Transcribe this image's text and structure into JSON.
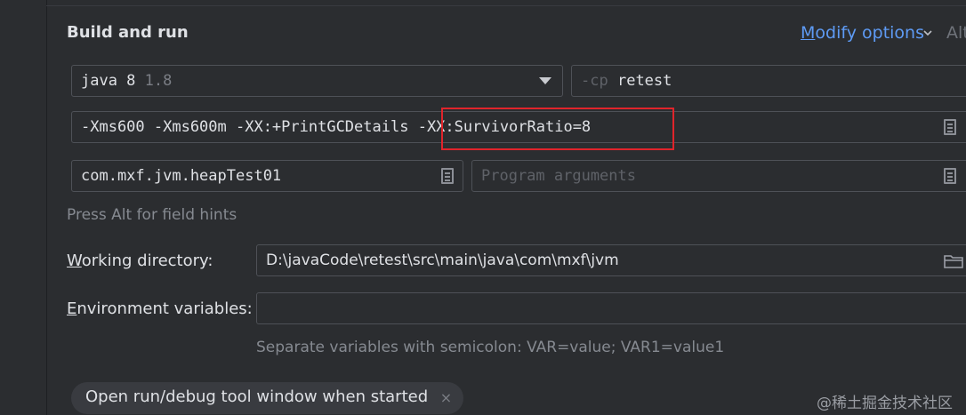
{
  "section": {
    "title": "Build and run"
  },
  "modify_options": {
    "underline_letter": "M",
    "rest": "odify options"
  },
  "alt_hint_top": "Alt",
  "jdk_select": {
    "name": "java 8",
    "version": "1.8"
  },
  "classpath": {
    "prefix": "-cp",
    "value": "retest"
  },
  "vm_options": {
    "before": "-Xms600 -Xms600m -XX:+PrintGCDetails ",
    "highlighted": "-XX:SurvivorRatio=8"
  },
  "main_class": {
    "value": "com.mxf.jvm.heapTest01"
  },
  "program_args": {
    "placeholder": "Program arguments"
  },
  "field_hint": "Press Alt for field hints",
  "working_dir": {
    "label_u": "W",
    "label_rest": "orking directory:",
    "value": "D:\\javaCode\\retest\\src\\main\\java\\com\\mxf\\jvm"
  },
  "env_vars": {
    "label_u": "E",
    "label_rest": "nvironment variables:",
    "value": "",
    "hint": "Separate variables with semicolon: VAR=value; VAR1=value1"
  },
  "chip": {
    "label": "Open run/debug tool window when started",
    "close": "×"
  },
  "watermark": "@稀土掘金技术社区",
  "colors": {
    "accent": "#5e9bf5",
    "highlight_border": "#e0242b",
    "background": "#2b2d30"
  }
}
